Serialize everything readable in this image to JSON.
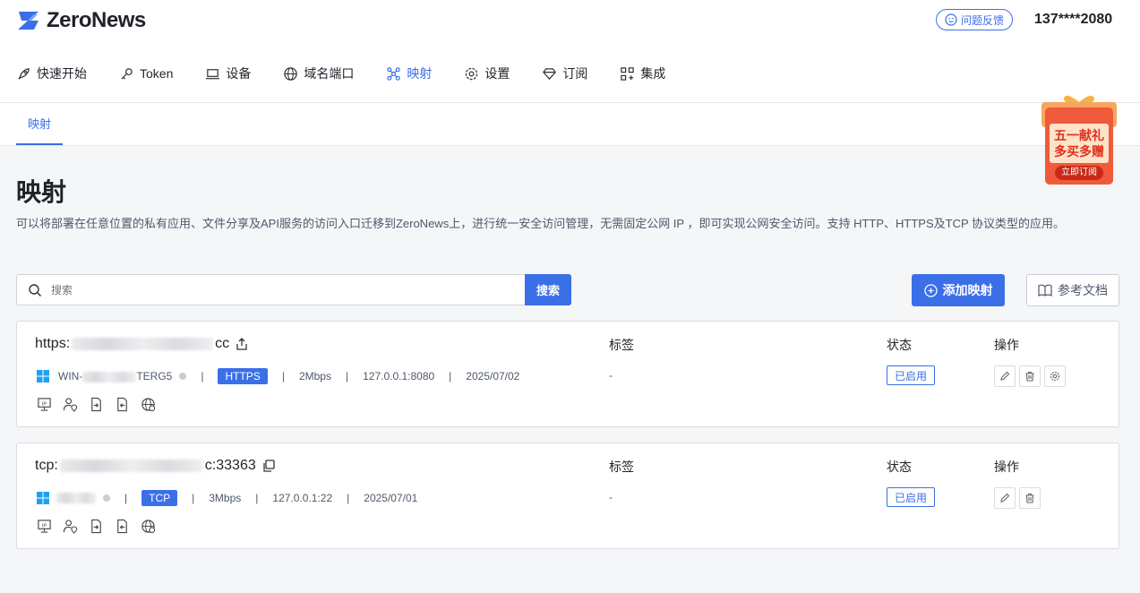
{
  "app": {
    "name": "ZeroNews"
  },
  "header": {
    "feedback_label": "问题反馈",
    "phone": "137****2080"
  },
  "nav": [
    {
      "label": "快速开始",
      "icon": "rocket-icon"
    },
    {
      "label": "Token",
      "icon": "key-icon"
    },
    {
      "label": "设备",
      "icon": "laptop-icon"
    },
    {
      "label": "域名端口",
      "icon": "globe-icon"
    },
    {
      "label": "映射",
      "icon": "mapping-icon",
      "active": true
    },
    {
      "label": "设置",
      "icon": "gear-icon"
    },
    {
      "label": "订阅",
      "icon": "diamond-icon"
    },
    {
      "label": "集成",
      "icon": "grid-icon"
    }
  ],
  "subtab": "映射",
  "promo": {
    "line1": "五一献礼",
    "line2": "多买多赠",
    "cta": "立即订阅"
  },
  "page": {
    "title": "映射",
    "description": "可以将部署在任意位置的私有应用、文件分享及API服务的访问入口迁移到ZeroNews上，进行统一安全访问管理，无需固定公网 IP ，即可实现公网安全访问。支持 HTTP、HTTPS及TCP 协议类型的应用。"
  },
  "search": {
    "placeholder": "搜索",
    "button": "搜索"
  },
  "actions": {
    "add": "添加映射",
    "docs": "参考文档"
  },
  "columns": {
    "tag": "标签",
    "status": "状态",
    "ops": "操作"
  },
  "mappings": [
    {
      "addr_prefix": "https:",
      "addr_suffix": "cc",
      "device_prefix": "WIN-",
      "device_suffix": "TERG5",
      "protocol": "HTTPS",
      "bandwidth": "2Mbps",
      "local": "127.0.0.1:8080",
      "date": "2025/07/02",
      "tag": "-",
      "status": "已启用"
    },
    {
      "addr_prefix": "tcp:",
      "addr_suffix": "c:33363",
      "device_prefix": "",
      "device_suffix": "",
      "protocol": "TCP",
      "bandwidth": "3Mbps",
      "local": "127.0.0.1:22",
      "date": "2025/07/01",
      "tag": "-",
      "status": "已启用"
    }
  ],
  "colors": {
    "primary": "#3b6fe8",
    "windows": "#1ea0f2"
  }
}
